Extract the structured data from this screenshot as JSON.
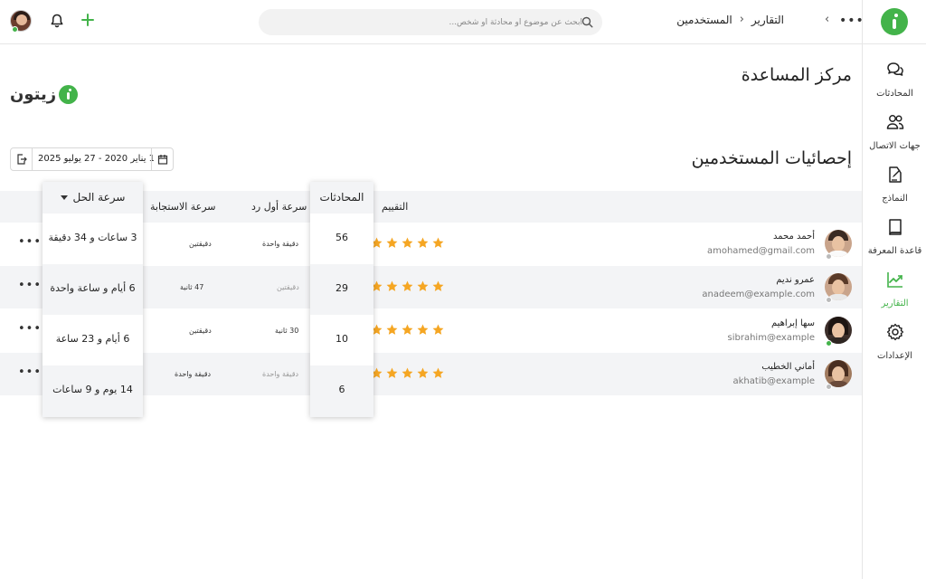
{
  "topbar": {
    "search_placeholder": "ابحث عن موضوع أو محادثة أو شخص...",
    "breadcrumb": [
      "التقارير",
      "المستخدمين"
    ]
  },
  "sidebar": {
    "items": [
      {
        "label": "المحادثات",
        "icon": "chat-icon",
        "active": false
      },
      {
        "label": "جهات الاتصال",
        "icon": "contacts-icon",
        "active": false
      },
      {
        "label": "النماذج",
        "icon": "forms-icon",
        "active": false
      },
      {
        "label": "قاعدة المعرفة",
        "icon": "book-icon",
        "active": false
      },
      {
        "label": "التقارير",
        "icon": "chart-icon",
        "active": true
      },
      {
        "label": "الإعدادات",
        "icon": "gear-icon",
        "active": false
      }
    ]
  },
  "page": {
    "title": "مركز المساعدة",
    "brand": "زيتون",
    "section_title": "إحصائيات المستخدمين",
    "date_range": "1 يناير 2020 - 27 يوليو 2025"
  },
  "table": {
    "headers": {
      "rating": "التقييم",
      "conversations": "المحادثات",
      "first_reply": "سرعة أول رد",
      "response": "سرعة الاستجابة",
      "resolution": "سرعة الحل"
    },
    "rows": [
      {
        "name": "أحمد محمد",
        "email": "amohamed@gmail.com",
        "online": false,
        "rating": 5,
        "conversations": "56",
        "first_reply": "دقيقة واحدة",
        "first_reply_muted": false,
        "response": "دقيقتين",
        "resolution": "3 ساعات و 34 دقيقة"
      },
      {
        "name": "عمرو نديم",
        "email": "anadeem@example.com",
        "online": false,
        "rating": 5,
        "conversations": "29",
        "first_reply": "دقيقتين",
        "first_reply_muted": true,
        "response": "47 ثانية",
        "resolution": "6 أيام و ساعة واحدة"
      },
      {
        "name": "سها إبراهيم",
        "email": "sibrahim@example",
        "online": true,
        "rating": 5,
        "conversations": "10",
        "first_reply": "30 ثانية",
        "first_reply_muted": false,
        "response": "دقيقتين",
        "resolution": "6 أيام و 23 ساعة"
      },
      {
        "name": "أماني الخطيب",
        "email": "akhatib@example",
        "online": false,
        "rating": 5,
        "conversations": "6",
        "first_reply": "دقيقة واحدة",
        "first_reply_muted": true,
        "response": "دقيقة واحدة",
        "resolution": "14 يوم و 9 ساعات"
      }
    ]
  },
  "colors": {
    "accent": "#43b34a",
    "star": "#f5a623",
    "row_alt": "#f3f4f6"
  }
}
